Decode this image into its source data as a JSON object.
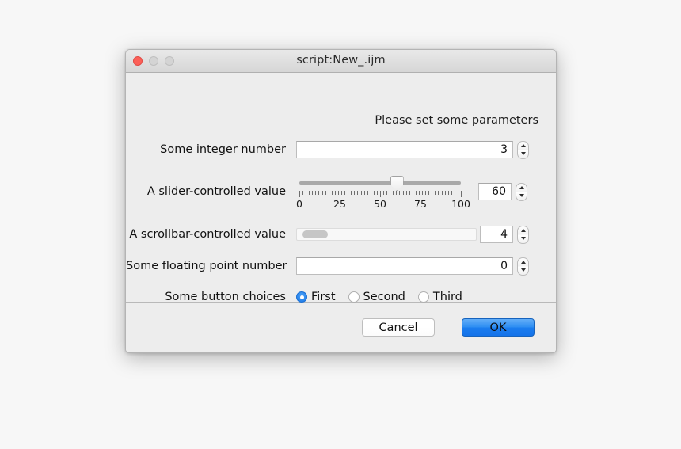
{
  "window": {
    "title": "script:New_.ijm",
    "traffic_lights": [
      "close",
      "minimize",
      "maximize"
    ]
  },
  "content": {
    "header": "Please set some parameters",
    "rows": [
      {
        "label": "Some integer number",
        "type": "textfield-spinner",
        "value": "3"
      },
      {
        "label": "A slider-controlled value",
        "type": "slider",
        "value": "60",
        "min": 0,
        "max": 100,
        "tick_labels": [
          "0",
          "25",
          "50",
          "75",
          "100"
        ]
      },
      {
        "label": "A scrollbar-controlled value",
        "type": "scrollbar",
        "value": "4",
        "min": 0,
        "max": 100,
        "thumb_position_percent": 2
      },
      {
        "label": "Some floating point number",
        "type": "textfield-spinner",
        "value": "0"
      },
      {
        "label": "Some button choices",
        "type": "radio-group",
        "options": [
          "First",
          "Second",
          "Third"
        ],
        "selected": "First"
      }
    ]
  },
  "footer": {
    "cancel_label": "Cancel",
    "ok_label": "OK"
  },
  "colors": {
    "accent": "#1b7def",
    "close_light": "#fc6058",
    "inactive_light": "#d4d4d4",
    "panel": "#ededed"
  }
}
